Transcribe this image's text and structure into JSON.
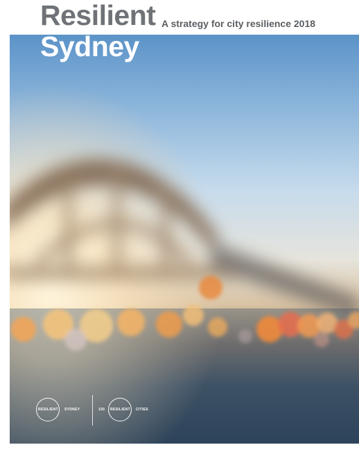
{
  "cover": {
    "title_line1": "Resilient",
    "title_line2": "Sydney",
    "tagline": "A strategy for city resilience 2018"
  },
  "logos": {
    "resilient_sydney": {
      "ring_text": "RESILIENT",
      "side_text": "SYDNEY"
    },
    "hundred_resilient_cities": {
      "number_text": "100",
      "ring_text": "RESILIENT",
      "side_text": "CITIES"
    }
  },
  "colors": {
    "title_grey": "#6f7377",
    "title_white": "#ffffff",
    "sky_top": "#4f8fc9",
    "sky_mid": "#bcd6ea",
    "glow": "#fff2d2",
    "water": "#2f4860"
  }
}
